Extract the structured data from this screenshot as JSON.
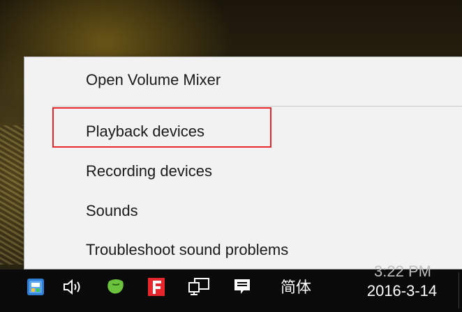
{
  "context_menu": {
    "items": [
      {
        "label": "Open Volume Mixer"
      },
      {
        "label": "Playback devices"
      },
      {
        "label": "Recording devices"
      },
      {
        "label": "Sounds"
      },
      {
        "label": "Troubleshoot sound problems"
      }
    ],
    "highlighted_item": "Playback devices",
    "highlight_color": "#e8262b"
  },
  "taskbar": {
    "tray_icons": [
      "input-method-icon",
      "volume-icon",
      "green-app-icon",
      "red-f-app-icon",
      "network-icon",
      "action-center-icon"
    ],
    "ime_label": "简体",
    "clock": {
      "time": "3:22 PM",
      "date": "2016-3-14"
    }
  }
}
